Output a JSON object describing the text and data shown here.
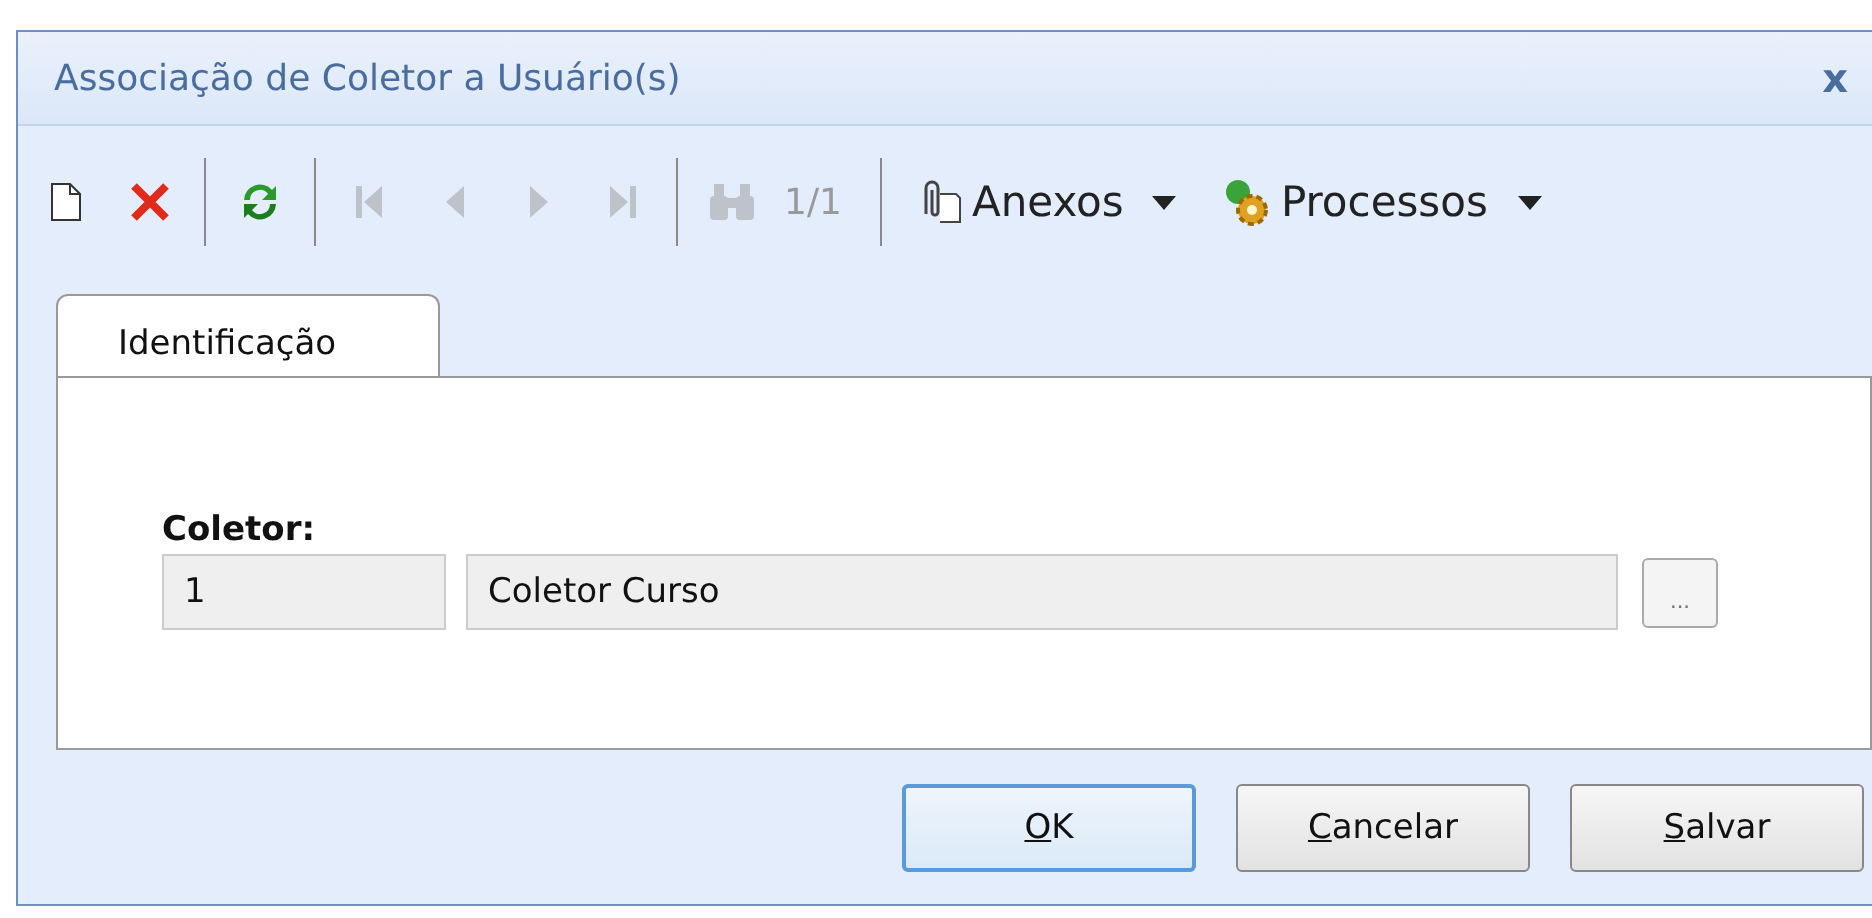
{
  "window": {
    "title": "Associação de Coletor a Usuário(s)",
    "close": "x"
  },
  "toolbar": [
    {
      "kind": "new",
      "disabled": false
    },
    {
      "kind": "delete",
      "disabled": false
    },
    {
      "kind": "separator"
    },
    {
      "kind": "refresh",
      "disabled": false
    },
    {
      "kind": "separator"
    },
    {
      "kind": "first",
      "disabled": true
    },
    {
      "kind": "prev",
      "disabled": true
    },
    {
      "kind": "next",
      "disabled": true
    },
    {
      "kind": "last",
      "disabled": true
    },
    {
      "kind": "separator"
    },
    {
      "kind": "find",
      "disabled": true
    },
    {
      "kind": "counter",
      "text": "1/1",
      "disabled": true
    },
    {
      "kind": "separator"
    },
    {
      "kind": "attachments",
      "label": "Anexos",
      "disabled": false
    },
    {
      "kind": "processes",
      "label": "Processos",
      "disabled": false
    }
  ],
  "tabs": [
    {
      "label": "Identificação",
      "selected": true
    }
  ],
  "form": {
    "label": "Coletor:",
    "code": "1",
    "description": "Coletor Curso",
    "lookup": "..."
  },
  "buttons": [
    {
      "label": "OK",
      "focused": true
    },
    {
      "label": "Cancelar",
      "focused": false
    },
    {
      "label": "Salvar",
      "focused": false
    }
  ]
}
